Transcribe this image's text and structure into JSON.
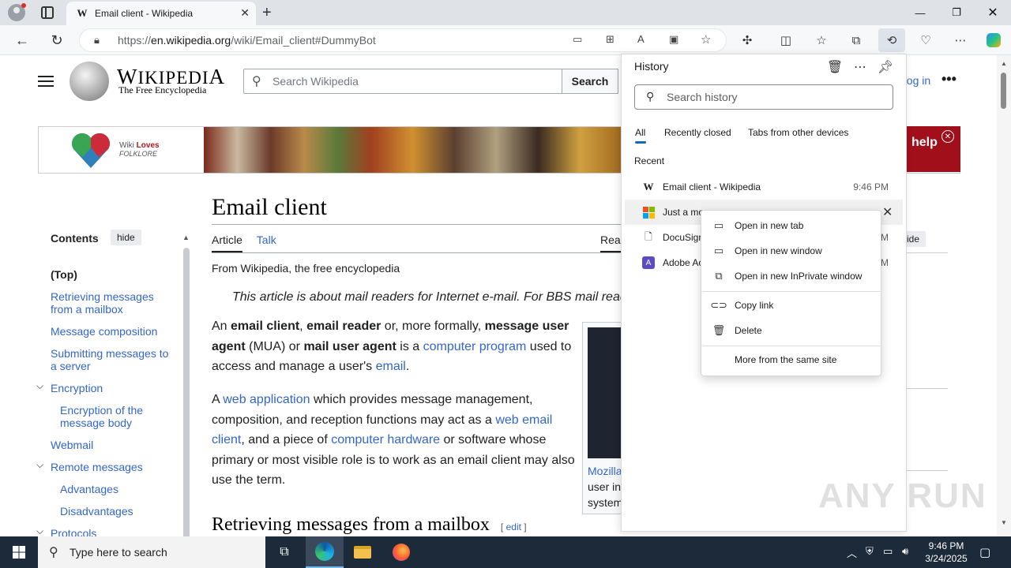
{
  "browser": {
    "tab_title": "Email client - Wikipedia",
    "url_prefix": "https://",
    "url_host": "en.wikipedia.org",
    "url_path": "/wiki/Email_client#DummyBot"
  },
  "wiki": {
    "wordmark": "Wikipedia",
    "tagline": "The Free Encyclopedia",
    "search_placeholder": "Search Wikipedia",
    "search_button": "Search",
    "login": "Log in",
    "banner_logo_a": "Wiki",
    "banner_logo_b": "Loves",
    "banner_logo_c": "FOLKLORE",
    "banner_help": "help",
    "title": "Email client",
    "tab_article": "Article",
    "tab_talk": "Talk",
    "tab_read": "Rea",
    "from": "From Wikipedia, the free encyclopedia",
    "hatnote": "This article is about mail readers for Internet e-mail. For BBS mail read",
    "p1": [
      {
        "t": "An ",
        "s": "n"
      },
      {
        "t": "email client",
        "s": "b"
      },
      {
        "t": ", ",
        "s": "n"
      },
      {
        "t": "email reader",
        "s": "b"
      },
      {
        "t": " or, more formally, ",
        "s": "n"
      },
      {
        "t": "message user agent",
        "s": "b"
      },
      {
        "t": " (MUA) or ",
        "s": "n"
      },
      {
        "t": "mail user agent",
        "s": "b"
      },
      {
        "t": " is a ",
        "s": "n"
      },
      {
        "t": "computer program",
        "s": "l"
      },
      {
        "t": " used to access and manage a user's ",
        "s": "n"
      },
      {
        "t": "email",
        "s": "l"
      },
      {
        "t": ".",
        "s": "n"
      }
    ],
    "p2": [
      {
        "t": "A ",
        "s": "n"
      },
      {
        "t": "web application",
        "s": "l"
      },
      {
        "t": " which provides message management, composition, and reception functions may act as a ",
        "s": "n"
      },
      {
        "t": "web email client",
        "s": "l"
      },
      {
        "t": ", and a piece of ",
        "s": "n"
      },
      {
        "t": "computer hardware",
        "s": "l"
      },
      {
        "t": " or software whose primary or most visible role is to work as an email client may also use the term.",
        "s": "n"
      }
    ],
    "thumb_caption_link": "Mozilla",
    "thumb_caption_rest1": "user in",
    "thumb_caption_rest2": "system",
    "section_heading": "Retrieving messages from a mailbox",
    "edit": "edit",
    "right_hide": "ide",
    "toc": {
      "title": "Contents",
      "hide": "hide",
      "items": [
        {
          "label": "(Top)",
          "top": true
        },
        {
          "label": "Retrieving messages from a mailbox"
        },
        {
          "label": "Message composition"
        },
        {
          "label": "Submitting messages to a server"
        },
        {
          "label": "Encryption",
          "expand": true
        },
        {
          "label": "Encryption of the message body",
          "sub": true
        },
        {
          "label": "Webmail"
        },
        {
          "label": "Remote messages",
          "expand": true
        },
        {
          "label": "Advantages",
          "sub": true
        },
        {
          "label": "Disadvantages",
          "sub": true
        },
        {
          "label": "Protocols",
          "expand": true
        }
      ]
    }
  },
  "history": {
    "title": "History",
    "search_placeholder": "Search history",
    "tabs": [
      "All",
      "Recently closed",
      "Tabs from other devices"
    ],
    "recent_label": "Recent",
    "items": [
      {
        "title": "Email client - Wikipedia",
        "time": "9:46 PM",
        "icon": "wikipedia-icon"
      },
      {
        "title": "Just a mo",
        "time": "",
        "icon": "microsoft-icon"
      },
      {
        "title": "DocuSigr",
        "time": "M",
        "icon": "document-icon"
      },
      {
        "title": "Adobe Ac",
        "time": "M",
        "icon": "adobe-icon"
      }
    ]
  },
  "context_menu": {
    "items": [
      {
        "label": "Open in new tab",
        "icon": "new-tab-icon"
      },
      {
        "label": "Open in new window",
        "icon": "new-window-icon"
      },
      {
        "label": "Open in new InPrivate window",
        "icon": "inprivate-icon"
      },
      {
        "label": "Copy link",
        "icon": "link-icon"
      },
      {
        "label": "Delete",
        "icon": "trash-icon"
      },
      {
        "label": "More from the same site",
        "icon": ""
      }
    ]
  },
  "taskbar": {
    "search_placeholder": "Type here to search",
    "time": "9:46 PM",
    "date": "3/24/2025"
  },
  "watermark": "ANY RUN",
  "colors": {
    "link": "#3366cc",
    "accent": "#0f6cbd",
    "banner_red": "#a10f1a"
  }
}
